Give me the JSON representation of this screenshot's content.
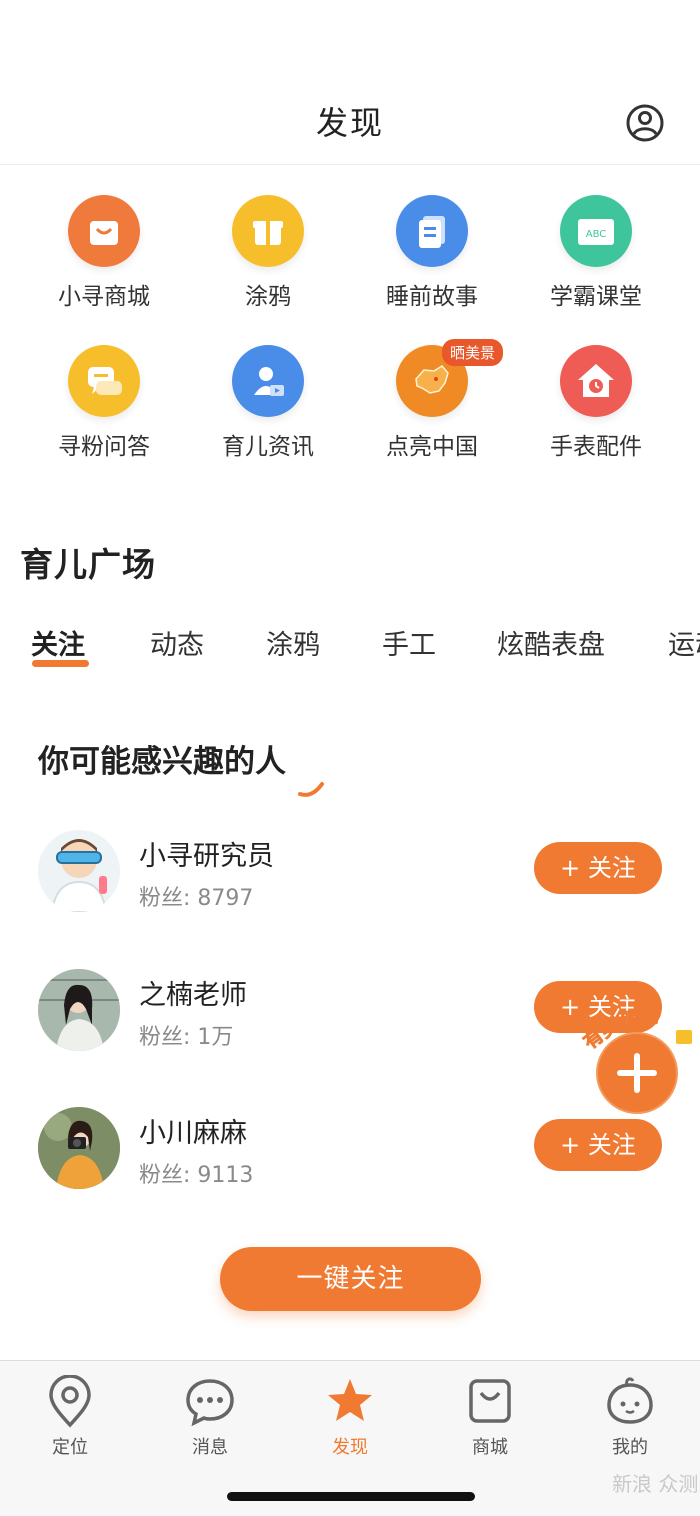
{
  "header": {
    "title": "发现"
  },
  "grid": [
    {
      "label": "小寻商城",
      "icon": "shopping-bag-icon",
      "color": "#ef7a3c"
    },
    {
      "label": "涂鸦",
      "icon": "gift-icon",
      "color": "#f7be2c"
    },
    {
      "label": "睡前故事",
      "icon": "book-icon",
      "color": "#4a8de8"
    },
    {
      "label": "学霸课堂",
      "icon": "blackboard-icon",
      "color": "#3fc59c",
      "icon_text": "ABC"
    },
    {
      "label": "寻粉问答",
      "icon": "chat-bubble-icon",
      "color": "#f7be2c"
    },
    {
      "label": "育儿资讯",
      "icon": "person-video-icon",
      "color": "#4a8de8"
    },
    {
      "label": "点亮中国",
      "icon": "china-map-icon",
      "color": "#f08a24",
      "badge": "晒美景"
    },
    {
      "label": "手表配件",
      "icon": "house-clock-icon",
      "color": "#ef5b55"
    }
  ],
  "section": {
    "title": "育儿广场"
  },
  "tabs": [
    {
      "label": "关注",
      "active": true
    },
    {
      "label": "动态"
    },
    {
      "label": "涂鸦"
    },
    {
      "label": "手工"
    },
    {
      "label": "炫酷表盘"
    },
    {
      "label": "运动"
    }
  ],
  "suggest": {
    "title": "你可能感兴趣的人"
  },
  "people": [
    {
      "name": "小寻研究员",
      "fans": "粉丝: 8797",
      "follow": "+ 关注"
    },
    {
      "name": "之楠老师",
      "fans": "粉丝: 1万",
      "follow": "+ 关注"
    },
    {
      "name": "小川麻麻",
      "fans": "粉丝: 9113",
      "follow": "+ 关注"
    }
  ],
  "fab": {
    "label": "有奖发布"
  },
  "follow_all": "一键关注",
  "tabbar": [
    {
      "label": "定位",
      "icon": "location-pin-icon"
    },
    {
      "label": "消息",
      "icon": "message-icon"
    },
    {
      "label": "发现",
      "icon": "star-icon",
      "active": true
    },
    {
      "label": "商城",
      "icon": "bag-icon"
    },
    {
      "label": "我的",
      "icon": "cute-face-icon"
    }
  ],
  "watermark": "新浪 众测",
  "colors": {
    "accent": "#f07a32",
    "text": "#222222",
    "muted": "#8a8a8a"
  }
}
